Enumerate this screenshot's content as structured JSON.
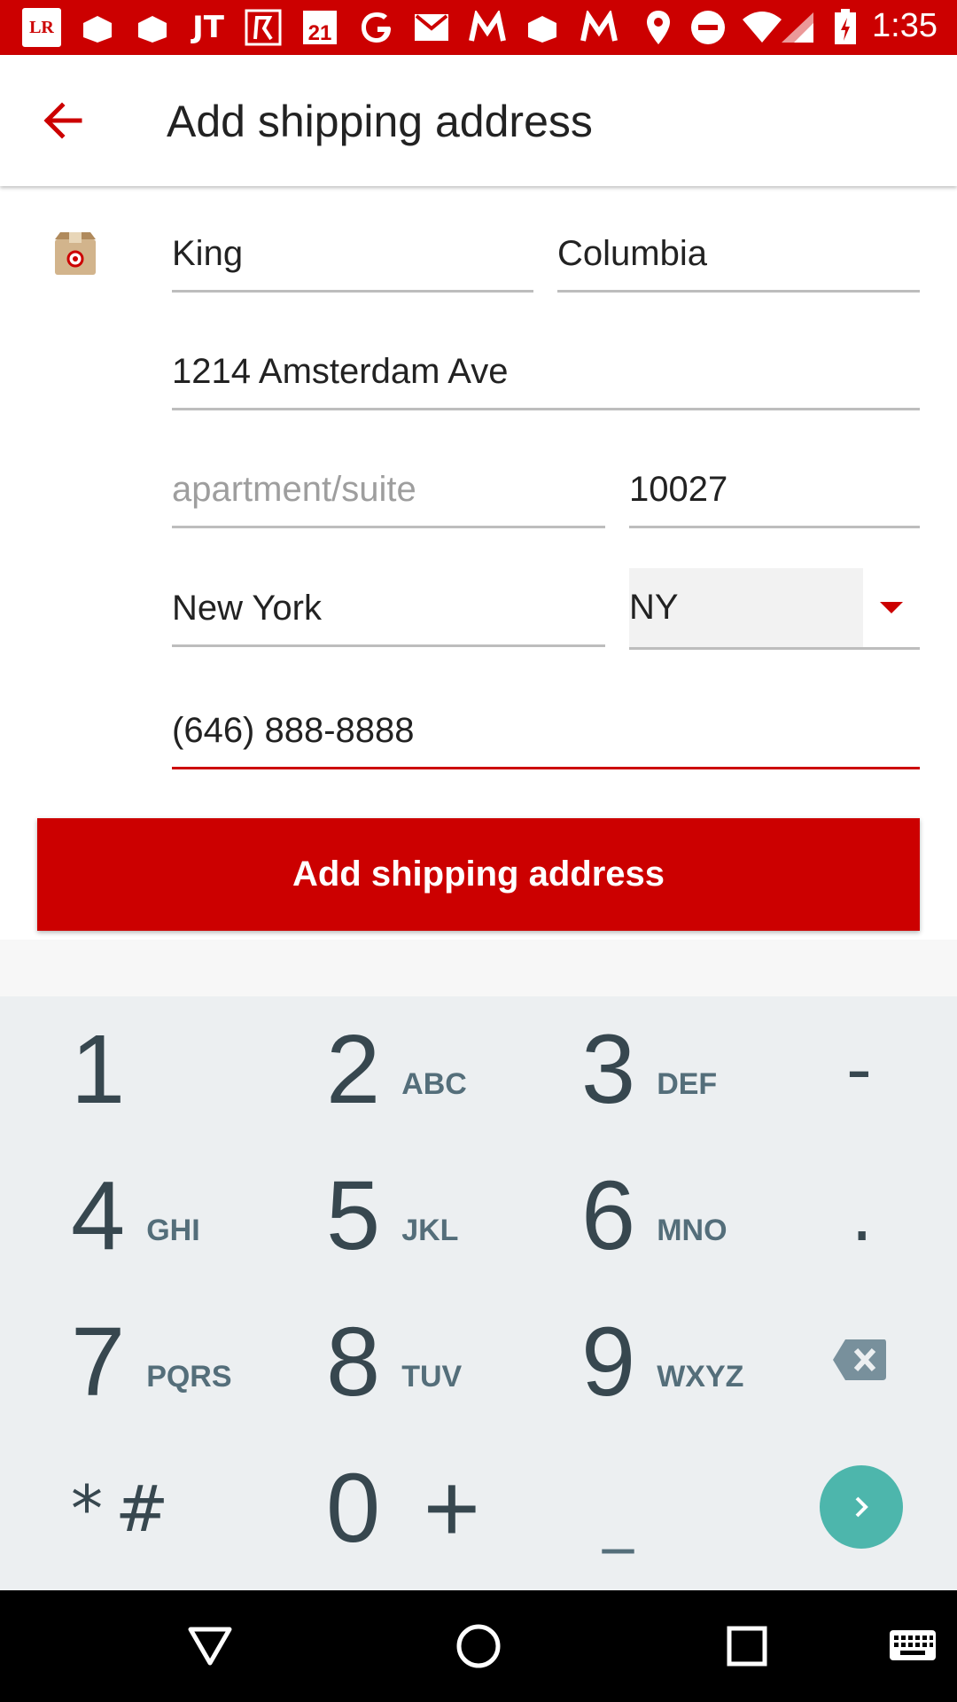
{
  "status_bar": {
    "icons": [
      "lr-icon",
      "box-icon",
      "box-icon",
      "jt-icon",
      "app-icon",
      "forever21-icon",
      "google-icon",
      "gmail-icon",
      "m-icon",
      "box-icon",
      "m-icon",
      "location-icon",
      "dnd-icon",
      "wifi-icon",
      "signal-icon",
      "battery-icon"
    ],
    "lr_text": "LR",
    "time": "1:35",
    "color": "#cc0000"
  },
  "header": {
    "title": "Add shipping address",
    "back_icon": "arrow-back-icon"
  },
  "form": {
    "first_name": "King",
    "last_name": "Columbia",
    "street": "1214 Amsterdam Ave",
    "apartment_placeholder": "apartment/suite",
    "zip": "10027",
    "city": "New York",
    "state": "NY",
    "phone": "(646) 888-8888",
    "submit_label": "Add shipping address"
  },
  "keypad": {
    "keys": [
      {
        "num": "1",
        "letters": ""
      },
      {
        "num": "2",
        "letters": "ABC"
      },
      {
        "num": "3",
        "letters": "DEF"
      },
      {
        "num": "-",
        "letters": ""
      },
      {
        "num": "4",
        "letters": "GHI"
      },
      {
        "num": "5",
        "letters": "JKL"
      },
      {
        "num": "6",
        "letters": "MNO"
      },
      {
        "num": ".",
        "letters": ""
      },
      {
        "num": "7",
        "letters": "PQRS"
      },
      {
        "num": "8",
        "letters": "TUV"
      },
      {
        "num": "9",
        "letters": "WXYZ"
      },
      {
        "num": "backspace",
        "letters": ""
      },
      {
        "num": "*#",
        "letters": ""
      },
      {
        "num": "0 +",
        "letters": ""
      },
      {
        "num": "_",
        "letters": ""
      },
      {
        "num": "go",
        "letters": ""
      }
    ],
    "go_color": "#4db6ac"
  },
  "nav": {
    "icons": [
      "back-triangle-icon",
      "home-circle-icon",
      "recents-square-icon",
      "keyboard-icon"
    ]
  }
}
